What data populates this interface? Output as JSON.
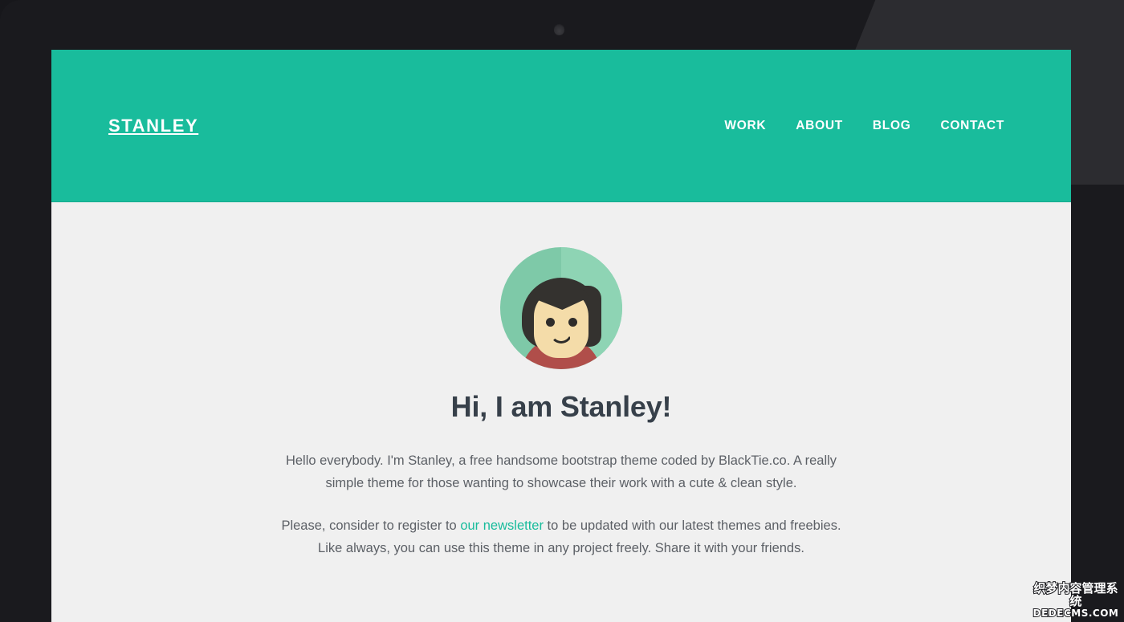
{
  "colors": {
    "brand_green": "#19bc9c",
    "screen_bg": "#f0f0f0",
    "device_frame": "#1a1a1e",
    "heading": "#37404a",
    "body_text": "#5c6066",
    "avatar_bg_left": "#7ec9a8",
    "avatar_bg_right": "#8ed4b4",
    "avatar_hair": "#34322f",
    "avatar_face": "#f4dca9",
    "avatar_shirt": "#b04e4a"
  },
  "header": {
    "brand": "STANLEY",
    "nav": [
      {
        "label": "WORK"
      },
      {
        "label": "ABOUT"
      },
      {
        "label": "BLOG"
      },
      {
        "label": "CONTACT"
      }
    ]
  },
  "hero": {
    "avatar_alt": "avatar-illustration",
    "title": "Hi, I am Stanley!",
    "paragraph_1": "Hello everybody. I'm Stanley, a free handsome bootstrap theme coded by BlackTie.co. A really simple theme for those wanting to showcase their work with a cute & clean style.",
    "paragraph_2_before": "Please, consider to register to ",
    "paragraph_2_link": "our newsletter",
    "paragraph_2_after": " to be updated with our latest themes and freebies. Like always, you can use this theme in any project freely. Share it with your friends."
  },
  "watermark": {
    "chinese": "织梦内容管理系统",
    "english": "DEDECMS.COM"
  }
}
